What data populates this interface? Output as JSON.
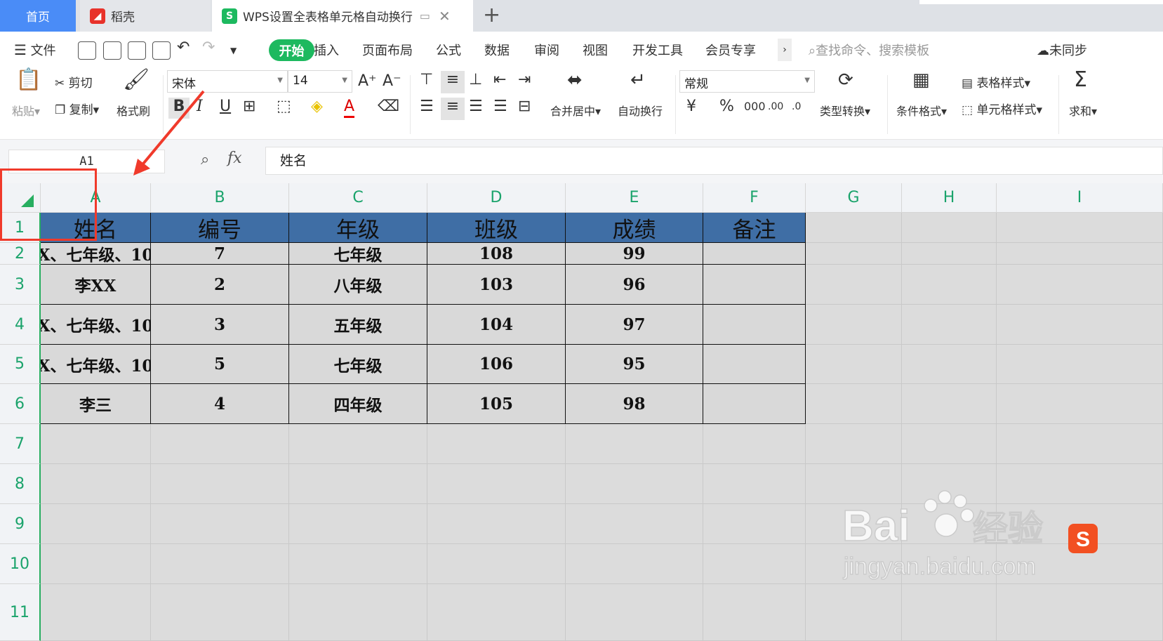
{
  "tabs": {
    "home": "首页",
    "daoke": "稻壳",
    "doc_title": "WPS设置全表格单元格自动换行"
  },
  "menu": {
    "file": "文件",
    "items": [
      "开始",
      "插入",
      "页面布局",
      "公式",
      "数据",
      "审阅",
      "视图",
      "开发工具",
      "会员专享"
    ],
    "search_placeholder": "查找命令、搜索模板",
    "sync": "未同步"
  },
  "ribbon": {
    "paste": "粘贴",
    "cut": "剪切",
    "copy": "复制",
    "format_painter": "格式刷",
    "font_name": "宋体",
    "font_size": "14",
    "merge_center": "合并居中",
    "auto_wrap": "自动换行",
    "number_format": "常规",
    "type_convert": "类型转换",
    "cond_format": "条件格式",
    "table_style": "表格样式",
    "cell_style": "单元格样式",
    "sum": "求和"
  },
  "formula_bar": {
    "cell_ref": "A1",
    "content": "姓名"
  },
  "sheet": {
    "columns": [
      "A",
      "B",
      "C",
      "D",
      "E",
      "F",
      "G",
      "H",
      "I"
    ],
    "rows": [
      "1",
      "2",
      "3",
      "4",
      "5",
      "6",
      "7",
      "8",
      "9",
      "10",
      "11"
    ],
    "header": [
      "姓名",
      "编号",
      "年级",
      "班级",
      "成绩",
      "备注"
    ],
    "data": [
      [
        "X、七年级、10",
        "7",
        "七年级",
        "108",
        "99",
        ""
      ],
      [
        "李XX",
        "2",
        "八年级",
        "103",
        "96",
        ""
      ],
      [
        "X、七年级、10",
        "3",
        "五年级",
        "104",
        "97",
        ""
      ],
      [
        "X、七年级、10",
        "5",
        "七年级",
        "106",
        "95",
        ""
      ],
      [
        "李三",
        "4",
        "四年级",
        "105",
        "98",
        ""
      ]
    ]
  },
  "watermark": {
    "brand": "Bai",
    "brand2": "经验",
    "url": "jingyan.baidu.com"
  },
  "colors": {
    "accent_green": "#1db95f",
    "tab_blue": "#4a8cf7",
    "table_header": "#3f6ea5",
    "highlight_red": "#f03a2b"
  }
}
